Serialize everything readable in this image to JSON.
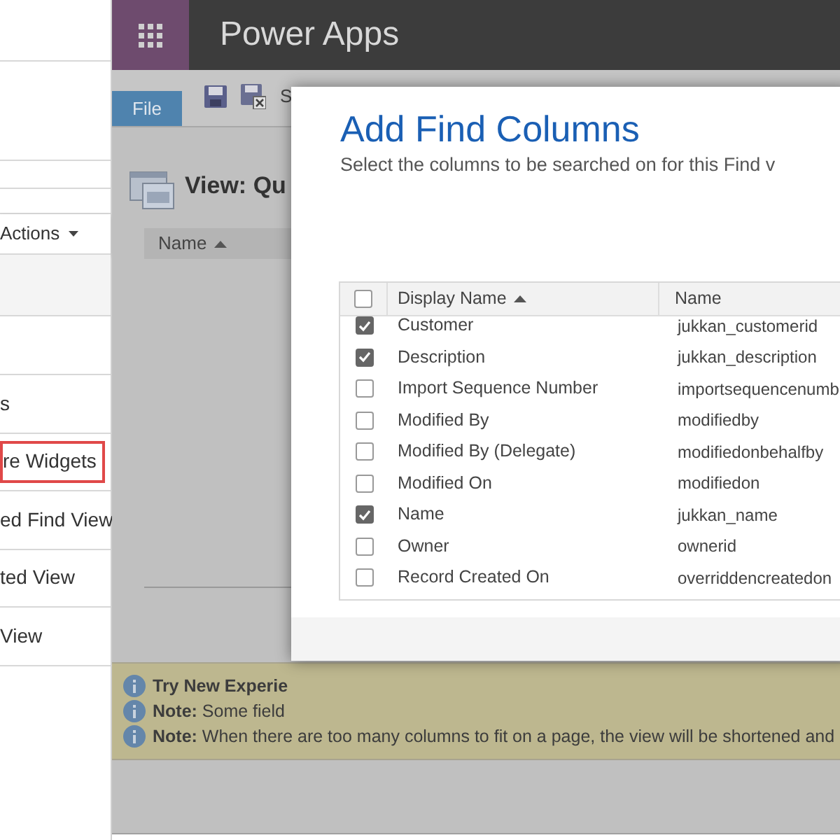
{
  "left_panel": {
    "actions_menu": "Actions",
    "items": [
      {
        "label": "s",
        "highlighted": false
      },
      {
        "label": "re Widgets",
        "highlighted": true
      },
      {
        "label": "ed Find View",
        "highlighted": false
      },
      {
        "label": "ted View",
        "highlighted": false
      },
      {
        "label": "View",
        "highlighted": false
      }
    ]
  },
  "app_bar": {
    "title": "Power Apps"
  },
  "ribbon": {
    "file_tab": "File",
    "save_label": "S"
  },
  "view": {
    "title": "View: Qu",
    "column": "Name"
  },
  "notifications": [
    {
      "text": "**Try New Experie**"
    },
    {
      "text": "**Note:** Some field"
    },
    {
      "text": "**Note:** When there are too many columns to fit on a page, the view will be shortened and"
    }
  ],
  "dialog": {
    "title": "Add Find Columns",
    "subtitle": "Select the columns to be searched on for this Find v",
    "header_checked": false,
    "columns": [
      "Display Name",
      "Name"
    ],
    "rows": [
      {
        "display_name": "Customer",
        "name": "jukkan_customerid",
        "checked": true
      },
      {
        "display_name": "Description",
        "name": "jukkan_description",
        "checked": true
      },
      {
        "display_name": "Import Sequence Number",
        "name": "importsequencenumb",
        "checked": false
      },
      {
        "display_name": "Modified By",
        "name": "modifiedby",
        "checked": false
      },
      {
        "display_name": "Modified By (Delegate)",
        "name": "modifiedonbehalfby",
        "checked": false
      },
      {
        "display_name": "Modified On",
        "name": "modifiedon",
        "checked": false
      },
      {
        "display_name": "Name",
        "name": "jukkan_name",
        "checked": true
      },
      {
        "display_name": "Owner",
        "name": "ownerid",
        "checked": false
      },
      {
        "display_name": "Record Created On",
        "name": "overriddencreatedon",
        "checked": false
      }
    ]
  }
}
